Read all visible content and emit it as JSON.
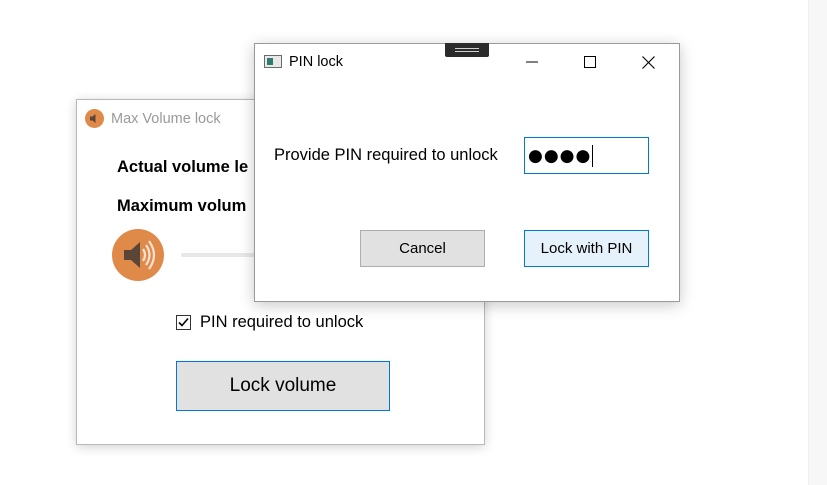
{
  "back_window": {
    "title": "Max Volume lock",
    "actual_volume_label": "Actual volume le",
    "maximum_volume_label": "Maximum volum",
    "pin_checkbox_label": "PIN required to unlock",
    "pin_checkbox_checked": true,
    "lock_button_label": "Lock volume",
    "icon": "speaker-icon",
    "accent_color": "#e08a4a"
  },
  "front_window": {
    "title": "PIN lock",
    "prompt": "Provide PIN required to unlock",
    "pin_value": "●●●●",
    "cancel_label": "Cancel",
    "lock_pin_label": "Lock with PIN",
    "controls": [
      "minimize-icon",
      "maximize-icon",
      "close-icon"
    ],
    "focus_color": "#0078d7"
  }
}
